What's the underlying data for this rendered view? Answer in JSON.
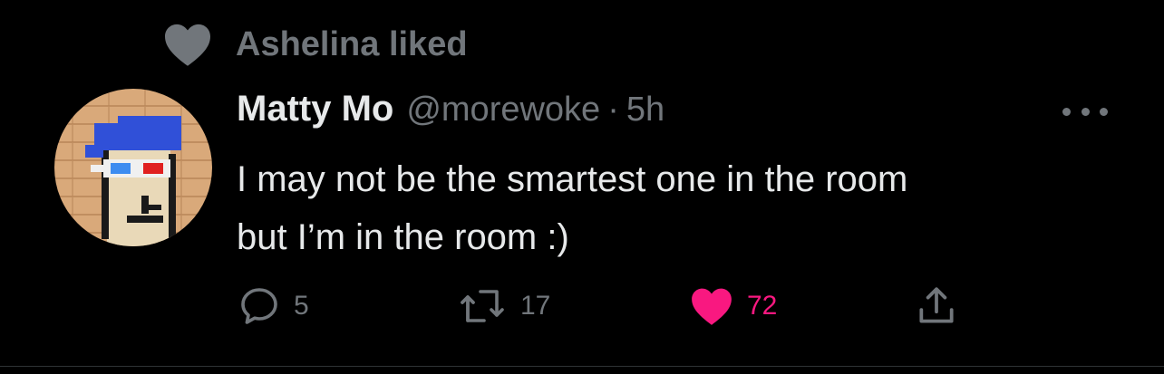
{
  "social_context": {
    "icon": "heart-icon",
    "text": "Ashelina liked"
  },
  "tweet": {
    "display_name": "Matty Mo",
    "handle": "@morewoke",
    "separator": "·",
    "time": "5h",
    "text": "I may not be the smartest one in the room\nbut I’m in the room :)",
    "avatar": "pixel-avatar-blue-bandana-3d-glasses"
  },
  "actions": {
    "reply": {
      "icon": "reply-icon",
      "count": "5"
    },
    "retweet": {
      "icon": "retweet-icon",
      "count": "17"
    },
    "like": {
      "icon": "heart-filled-icon",
      "count": "72",
      "color": "#f91880"
    },
    "share": {
      "icon": "share-icon"
    }
  },
  "colors": {
    "background": "#000000",
    "primary_text": "#e7e9ea",
    "secondary_text": "#71767b",
    "like": "#f91880"
  }
}
